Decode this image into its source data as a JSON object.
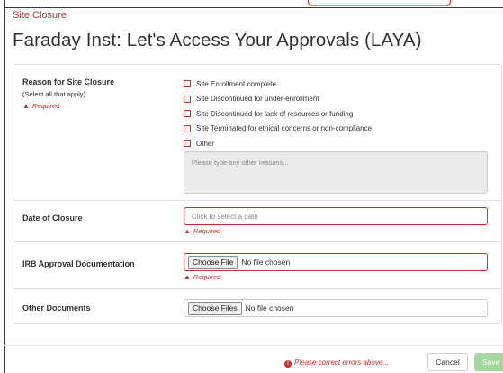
{
  "breadcrumb": "Site Closure",
  "page_title": "Faraday Inst: Let's Access Your Approvals (LAYA)",
  "colors": {
    "error": "#c9302c",
    "save_button": "#a4d89f"
  },
  "sections": {
    "reason": {
      "label": "Reason for Site Closure",
      "hint": "(Select all that apply)",
      "required": "Required",
      "options": [
        "Site Enrollment complete",
        "Site Discontinued for under-enrollment",
        "Site Discontinued for lack of resources or funding",
        "Site Terminated for ethical concerns or non-compliance",
        "Other"
      ],
      "other_placeholder": "Please type any other reasons..."
    },
    "date": {
      "label": "Date of Closure",
      "placeholder": "Click to select a date",
      "required": "Required"
    },
    "irb": {
      "label": "IRB Approval Documentation",
      "button": "Choose File",
      "status": "No file chosen",
      "required": "Required"
    },
    "other_docs": {
      "label": "Other Documents",
      "button": "Choose Files",
      "status": "No file chosen"
    }
  },
  "footer": {
    "error_message": "Please correct errors above...",
    "cancel": "Cancel",
    "save": "Save"
  }
}
